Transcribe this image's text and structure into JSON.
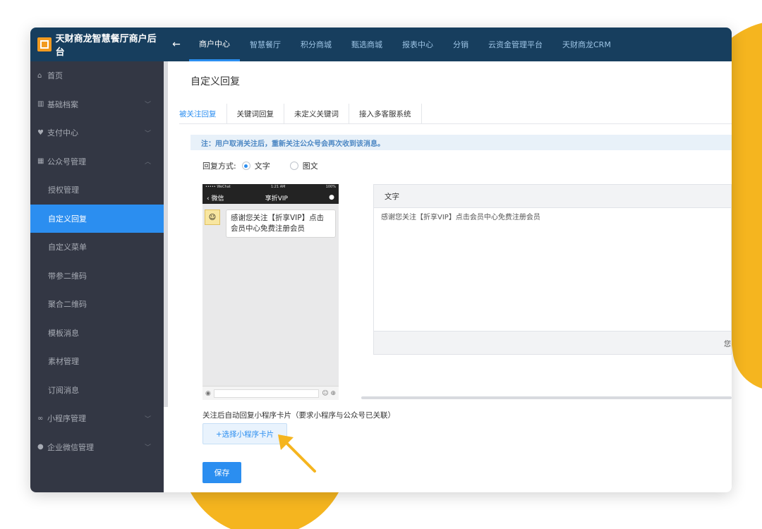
{
  "topbar": {
    "brand": "天财商龙智慧餐厅商户后台",
    "back_icon": "←",
    "nav": [
      {
        "label": "商户中心",
        "active": true
      },
      {
        "label": "智慧餐厅"
      },
      {
        "label": "积分商城"
      },
      {
        "label": "甄选商城"
      },
      {
        "label": "报表中心"
      },
      {
        "label": "分销"
      },
      {
        "label": "云资金管理平台"
      },
      {
        "label": "天财商龙CRM"
      }
    ]
  },
  "sidebar": {
    "items": [
      {
        "label": "首页",
        "icon": "home-icon"
      },
      {
        "label": "基础档案",
        "icon": "archive-icon"
      },
      {
        "label": "支付中心",
        "icon": "payment-icon"
      },
      {
        "label": "公众号管理",
        "icon": "official-account-icon"
      },
      {
        "label": "授权管理"
      },
      {
        "label": "自定义回复",
        "active": true
      },
      {
        "label": "自定义菜单"
      },
      {
        "label": "带参二维码"
      },
      {
        "label": "聚合二维码"
      },
      {
        "label": "模板消息"
      },
      {
        "label": "素材管理"
      },
      {
        "label": "订阅消息"
      },
      {
        "label": "小程序管理",
        "icon": "mini-program-icon"
      },
      {
        "label": "企业微信管理",
        "icon": "wecom-icon"
      }
    ]
  },
  "main": {
    "title": "自定义回复",
    "tabs": [
      {
        "label": "被关注回复",
        "active": true
      },
      {
        "label": "关键词回复"
      },
      {
        "label": "未定义关键词"
      },
      {
        "label": "接入多客服系统"
      }
    ],
    "notice": "注：用户取消关注后，重新关注公众号会再次收到该消息。",
    "reply_mode": {
      "label": "回复方式:",
      "options": [
        {
          "label": "文字",
          "checked": true
        },
        {
          "label": "图文",
          "checked": false
        }
      ]
    },
    "phone": {
      "status_left": "••••• WeChat",
      "status_time": "1:21 AM",
      "status_right": "100%",
      "back_label": "微信",
      "title": "享折VIP",
      "bubble": "感谢您关注【折享VIP】点击会员中心免费注册会员"
    },
    "editor": {
      "header": "文字",
      "content": "感谢您关注【折享VIP】点击会员中心免费注册会员",
      "footer_text": "您"
    },
    "mini_program": {
      "label": "关注后自动回复小程序卡片（要求小程序与公众号已关联）",
      "button": "+选择小程序卡片"
    },
    "save_button": "保存"
  },
  "colors": {
    "topbar": "#173e5e",
    "sidebar": "#333744",
    "accent": "#2b8ef0",
    "highlight": "#f5b51f"
  }
}
